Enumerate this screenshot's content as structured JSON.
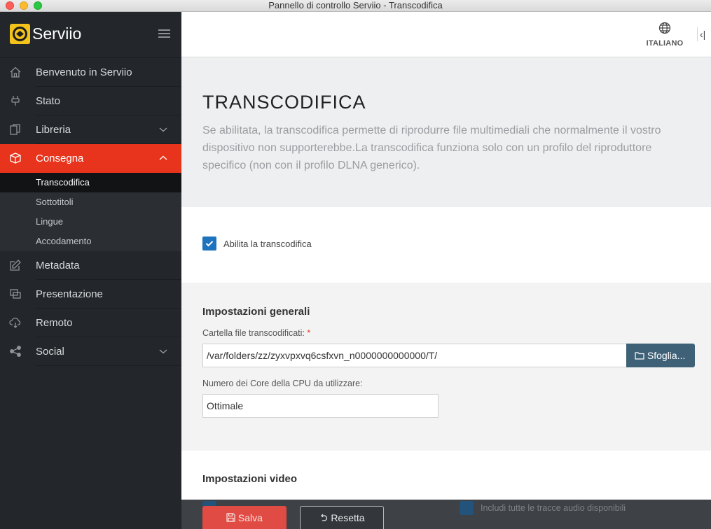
{
  "window": {
    "title": "Pannello di controllo Serviio - Transcodifica"
  },
  "brand": {
    "name": "Serviio"
  },
  "sidebar": {
    "items": [
      {
        "label": "Benvenuto in Serviio"
      },
      {
        "label": "Stato"
      },
      {
        "label": "Libreria"
      },
      {
        "label": "Consegna"
      },
      {
        "label": "Metadata"
      },
      {
        "label": "Presentazione"
      },
      {
        "label": "Remoto"
      },
      {
        "label": "Social"
      }
    ],
    "sub_items": [
      {
        "label": "Transcodifica"
      },
      {
        "label": "Sottotitoli"
      },
      {
        "label": "Lingue"
      },
      {
        "label": "Accodamento"
      }
    ]
  },
  "header": {
    "language": "ITALIANO",
    "collapse_glyph": "‹|"
  },
  "page": {
    "title": "TRANSCODIFICA",
    "description": "Se abilitata, la transcodifica permette di riprodurre file multimediali che normalmente il vostro dispositivo non supporterebbe.La transcodifica funziona solo con un profilo del riproduttore specifico (non con il profilo DLNA generico)."
  },
  "enable": {
    "label": "Abilita la transcodifica",
    "checked": true
  },
  "general": {
    "title": "Impostazioni generali",
    "folder_label": "Cartella file transcodificati:",
    "required_mark": "*",
    "folder_value": "/var/folders/zz/zyxvpxvq6csfxvn_n0000000000000/T/",
    "browse_label": "Sfoglia...",
    "cpu_label": "Numero dei Core della CPU da utilizzare:",
    "cpu_value": "Ottimale"
  },
  "video": {
    "title": "Impostazioni video",
    "audio_tracks_label": "Includi tutte le tracce audio disponibili"
  },
  "actions": {
    "save_label": "Salva",
    "reset_label": "Resetta"
  },
  "colors": {
    "accent": "#e8341c",
    "sidebar_bg": "#23272b",
    "checkbox": "#1e73be",
    "browse": "#3f6177",
    "logo": "#f3c21b"
  }
}
